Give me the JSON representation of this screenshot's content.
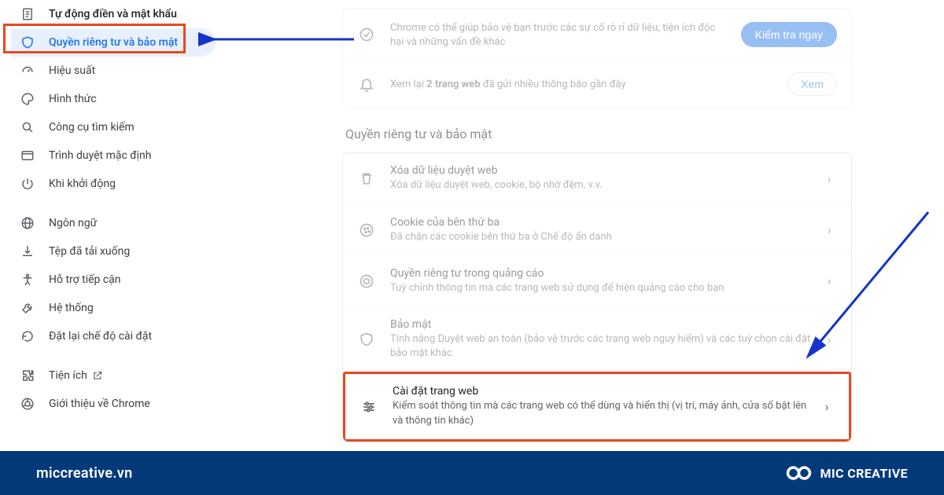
{
  "sidebar": {
    "items": [
      {
        "label": "Tự động điền và mật khẩu"
      },
      {
        "label": "Quyền riêng tư và bảo mật"
      },
      {
        "label": "Hiệu suất"
      },
      {
        "label": "Hình thức"
      },
      {
        "label": "Công cụ tìm kiếm"
      },
      {
        "label": "Trình duyệt mặc định"
      },
      {
        "label": "Khi khởi động"
      }
    ],
    "extra": [
      {
        "label": "Ngôn ngữ"
      },
      {
        "label": "Tệp đã tải xuống"
      },
      {
        "label": "Hỗ trợ tiếp cận"
      },
      {
        "label": "Hệ thống"
      },
      {
        "label": "Đặt lại chế độ cài đặt"
      }
    ],
    "footer": [
      {
        "label": "Tiện ích"
      },
      {
        "label": "Giới thiệu về Chrome"
      }
    ]
  },
  "safety": {
    "item1_desc": "Chrome có thể giúp bảo vệ bạn trước các sự cố rò rỉ dữ liệu, tiện ích độc hại và những vấn đề khác",
    "item1_btn": "Kiểm tra ngay",
    "item2_prefix": "Xem lại ",
    "item2_bold": "2 trang web",
    "item2_suffix": " đã gửi nhiều thông báo gần đây",
    "item2_btn": "Xem"
  },
  "privacy": {
    "heading": "Quyền riêng tư và bảo mật",
    "rows": [
      {
        "title": "Xóa dữ liệu duyệt web",
        "desc": "Xóa dữ liệu duyệt web, cookie, bộ nhớ đệm, v.v."
      },
      {
        "title": "Cookie của bên thứ ba",
        "desc": "Đã chặn các cookie bên thứ ba ở Chế độ ẩn danh"
      },
      {
        "title": "Quyền riêng tư trong quảng cáo",
        "desc": "Tuỳ chỉnh thông tin mà các trang web sử dụng để hiện quảng cáo cho bạn"
      },
      {
        "title": "Bảo mật",
        "desc": "Tính năng Duyệt web an toàn (bảo vệ trước các trang web nguy hiểm) và các tuỳ chọn cài đặt bảo mật khác"
      },
      {
        "title": "Cài đặt trang web",
        "desc": "Kiểm soát thông tin mà các trang web có thể dùng và hiển thị (vị trí, máy ảnh, cửa sổ bật lên và thông tin khác)"
      }
    ]
  },
  "footer": {
    "domain": "miccreative.vn",
    "brand": "MIC CREATIVE"
  }
}
